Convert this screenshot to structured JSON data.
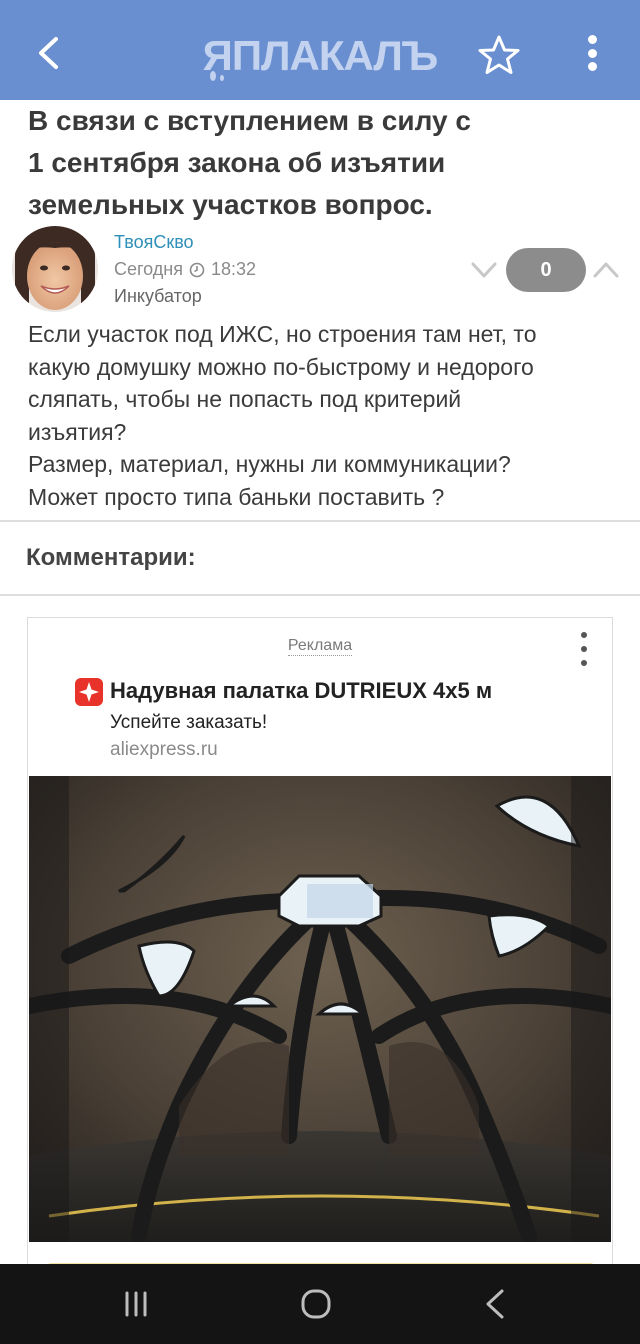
{
  "header": {
    "logo_text": "ЯПЛАКАЛЪ",
    "back_icon": "chevron-left-icon",
    "favorite_icon": "star-outline-icon",
    "menu_icon": "more-vertical-icon",
    "background_color": "#6a8fd0"
  },
  "post": {
    "title_lines": [
      "В связи с вступлением в силу с",
      "1 сентября закона об изъятии",
      "земельных участков вопрос."
    ],
    "author": "ТвояСкво",
    "date": "Сегодня",
    "time": "18:32",
    "group": "Инкубатор",
    "rating": "0",
    "body_lines": [
      "Если участок под ИЖС, но строения там нет, то",
      "какую домушку можно по-быстрому и недорого",
      "сляпать, чтобы не попасть под критерий",
      "изъятия?",
      "Размер, материал, нужны ли коммуникации?",
      "Может просто типа баньки поставить ?"
    ]
  },
  "comments": {
    "heading": "Комментарии:"
  },
  "ad": {
    "label": "Реклама",
    "title": "Надувная палатка DUTRIEUX 4x5 м",
    "subtitle": "Успейте заказать!",
    "domain": "aliexpress.ru",
    "brand_color": "#e8332a",
    "image_description_icon": "tent-interior-photo"
  },
  "navbar": {
    "recents_icon": "recent-apps-icon",
    "home_icon": "home-icon",
    "back_icon": "system-back-icon"
  }
}
